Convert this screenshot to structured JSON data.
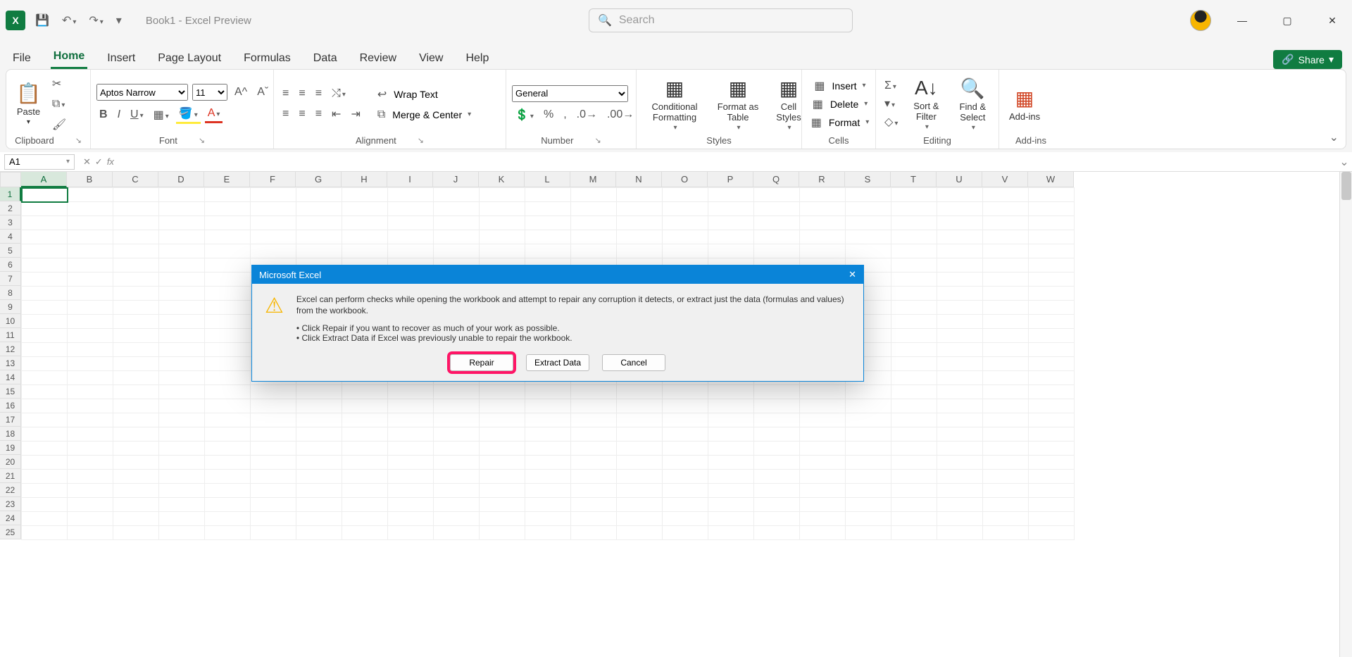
{
  "titlebar": {
    "document_title": "Book1  -  Excel Preview",
    "search_placeholder": "Search"
  },
  "tabs": [
    "File",
    "Home",
    "Insert",
    "Page Layout",
    "Formulas",
    "Data",
    "Review",
    "View",
    "Help"
  ],
  "active_tab": "Home",
  "share_label": "Share",
  "ribbon": {
    "clipboard": {
      "paste": "Paste",
      "group": "Clipboard"
    },
    "font": {
      "name": "Aptos Narrow",
      "size": "11",
      "group": "Font"
    },
    "alignment": {
      "wrap": "Wrap Text",
      "merge": "Merge & Center",
      "group": "Alignment"
    },
    "number": {
      "format": "General",
      "group": "Number"
    },
    "styles": {
      "cond": "Conditional Formatting",
      "table": "Format as Table",
      "cell": "Cell Styles",
      "group": "Styles"
    },
    "cells": {
      "insert": "Insert",
      "delete": "Delete",
      "format": "Format",
      "group": "Cells"
    },
    "editing": {
      "sort": "Sort & Filter",
      "find": "Find & Select",
      "group": "Editing"
    },
    "addins": {
      "label": "Add-ins",
      "group": "Add-ins"
    }
  },
  "formula_bar": {
    "name_box": "A1",
    "fx_label": "fx"
  },
  "columns": [
    "A",
    "B",
    "C",
    "D",
    "E",
    "F",
    "G",
    "H",
    "I",
    "J",
    "K",
    "L",
    "M",
    "N",
    "O",
    "P",
    "Q",
    "R",
    "S",
    "T",
    "U",
    "V",
    "W"
  ],
  "rows": [
    "1",
    "2",
    "3",
    "4",
    "5",
    "6",
    "7",
    "8",
    "9",
    "10",
    "11",
    "12",
    "13",
    "14",
    "15",
    "16",
    "17",
    "18",
    "19",
    "20",
    "21",
    "22",
    "23",
    "24",
    "25"
  ],
  "selected_cell": "A1",
  "dialog": {
    "title": "Microsoft Excel",
    "message": "Excel can perform checks while opening the workbook and attempt to repair any corruption it detects, or extract just the data (formulas and values) from the workbook.",
    "bullet1": "Click Repair if you want to recover as much of your work as possible.",
    "bullet2": "Click Extract Data if Excel was previously unable to repair the workbook.",
    "repair": "Repair",
    "extract": "Extract Data",
    "cancel": "Cancel"
  }
}
